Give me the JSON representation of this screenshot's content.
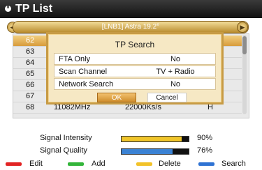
{
  "header": {
    "title": "TP List"
  },
  "satellite": {
    "name": "[LNB1] Astra 19.2°"
  },
  "tp_list": {
    "rows": [
      {
        "num": "62",
        "freq": "",
        "sym": "",
        "pol": "",
        "selected": true
      },
      {
        "num": "63",
        "freq": "",
        "sym": "",
        "pol": "",
        "selected": false
      },
      {
        "num": "64",
        "freq": "",
        "sym": "",
        "pol": "",
        "selected": false
      },
      {
        "num": "65",
        "freq": "",
        "sym": "",
        "pol": "",
        "selected": false
      },
      {
        "num": "66",
        "freq": "",
        "sym": "",
        "pol": "",
        "selected": false
      },
      {
        "num": "67",
        "freq": "",
        "sym": "",
        "pol": "",
        "selected": false
      },
      {
        "num": "68",
        "freq": "11082MHz",
        "sym": "22000Ks/s",
        "pol": "H",
        "selected": false
      }
    ]
  },
  "dialog": {
    "title": "TP Search",
    "fta_only": {
      "label": "FTA Only",
      "value": "No"
    },
    "scan_channel": {
      "label": "Scan Channel",
      "value": "TV + Radio"
    },
    "network_search": {
      "label": "Network Search",
      "value": "No"
    },
    "ok_label": "OK",
    "cancel_label": "Cancel"
  },
  "signal": {
    "intensity_label": "Signal Intensity",
    "intensity_value": "90%",
    "intensity_level": 0.9,
    "quality_label": "Signal Quality",
    "quality_value": "76%",
    "quality_level": 0.76
  },
  "help_bar": {
    "edit": "Edit",
    "add": "Add",
    "delete": "Delete",
    "search": "Search"
  },
  "colors": {
    "intensity_fill": "#f0c52a",
    "quality_fill": "#3a82d4",
    "key_red": "#e22424",
    "key_green": "#33b53a",
    "key_yellow": "#f2c229",
    "key_blue": "#2f73d3"
  }
}
